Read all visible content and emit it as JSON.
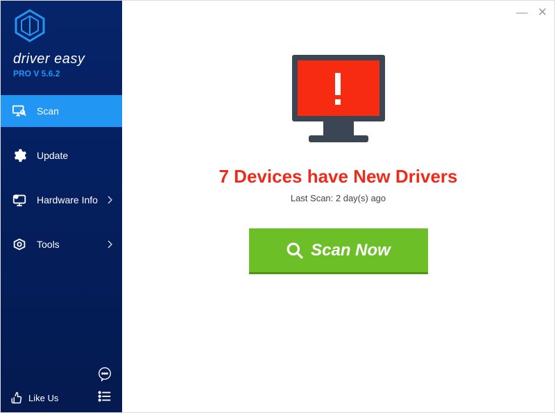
{
  "brand": {
    "name": "driver easy",
    "version": "PRO V 5.6.2"
  },
  "sidebar": {
    "items": [
      {
        "label": "Scan"
      },
      {
        "label": "Update"
      },
      {
        "label": "Hardware Info"
      },
      {
        "label": "Tools"
      }
    ],
    "like": "Like Us"
  },
  "main": {
    "heading": "7 Devices have New Drivers",
    "last_scan": "Last Scan: 2 day(s) ago",
    "scan_button": "Scan Now"
  }
}
